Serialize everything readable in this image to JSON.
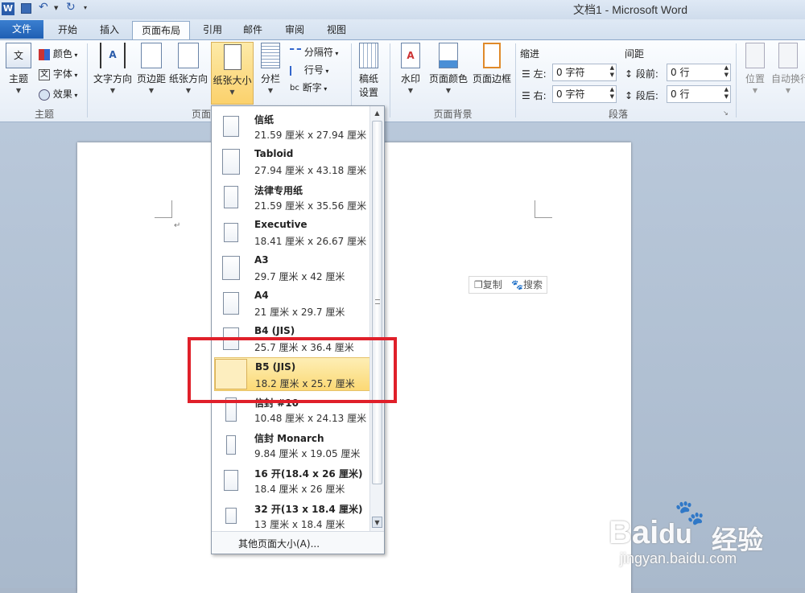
{
  "app": {
    "title": "文档1 - Microsoft Word",
    "word_icon": "W"
  },
  "tabs": {
    "file": "文件",
    "items": [
      "开始",
      "插入",
      "页面布局",
      "引用",
      "邮件",
      "审阅",
      "视图"
    ],
    "active": "页面布局"
  },
  "ribbon": {
    "theme_group": {
      "label": "主题",
      "main": "主题",
      "colors": "颜色",
      "fonts": "字体",
      "effects": "效果"
    },
    "page_setup": {
      "label": "页面",
      "text_direction": "文字方向",
      "margins": "页边距",
      "orientation": "纸张方向",
      "size": "纸张大小",
      "columns": "分栏",
      "breaks": "分隔符",
      "line_numbers": "行号",
      "hyphenation": "断字"
    },
    "draft": {
      "label": "稿纸设置",
      "line1": "稿纸",
      "line2": "设置"
    },
    "page_bg": {
      "label": "页面背景",
      "watermark": "水印",
      "page_color": "页面颜色",
      "page_border": "页面边框"
    },
    "paragraph": {
      "label": "段落",
      "indent_title": "缩进",
      "left_label": "左:",
      "left_value": "0 字符",
      "right_label": "右:",
      "right_value": "0 字符",
      "spacing_title": "间距",
      "before_label": "段前:",
      "before_value": "0 行",
      "after_label": "段后:",
      "after_value": "0 行"
    },
    "arrange": {
      "position": "位置",
      "wrap": "自动换行"
    }
  },
  "dropdown": {
    "items": [
      {
        "name": "信纸",
        "dims": "21.59 厘米 x 27.94 厘米"
      },
      {
        "name": "Tabloid",
        "dims": "27.94 厘米 x 43.18 厘米"
      },
      {
        "name": "法律专用纸",
        "dims": "21.59 厘米 x 35.56 厘米"
      },
      {
        "name": "Executive",
        "dims": "18.41 厘米 x 26.67 厘米"
      },
      {
        "name": "A3",
        "dims": "29.7 厘米 x 42 厘米"
      },
      {
        "name": "A4",
        "dims": "21 厘米 x 29.7 厘米"
      },
      {
        "name": "B4 (JIS)",
        "dims": "25.7 厘米 x 36.4 厘米"
      },
      {
        "name": "B5 (JIS)",
        "dims": "18.2 厘米 x 25.7 厘米"
      },
      {
        "name": "信封 #10",
        "dims": "10.48 厘米 x 24.13 厘米"
      },
      {
        "name": "信封 Monarch",
        "dims": "9.84 厘米 x 19.05 厘米"
      },
      {
        "name": "16 开(18.4 x 26 厘米)",
        "dims": "18.4 厘米 x 26 厘米"
      },
      {
        "name": "32 开(13 x 18.4 厘米)",
        "dims": "13 厘米 x 18.4 厘米"
      }
    ],
    "selected": "B5 (JIS)",
    "more": "其他页面大小(A)..."
  },
  "minibar": {
    "copy": "复制",
    "search": "搜索"
  },
  "watermark": {
    "brand": "Bai",
    "brand2": "经验",
    "url": "jingyan.baidu.com"
  },
  "colors": {
    "accent": "#1f5fb3",
    "highlight": "#fcd975",
    "annotation": "#e0202a"
  }
}
